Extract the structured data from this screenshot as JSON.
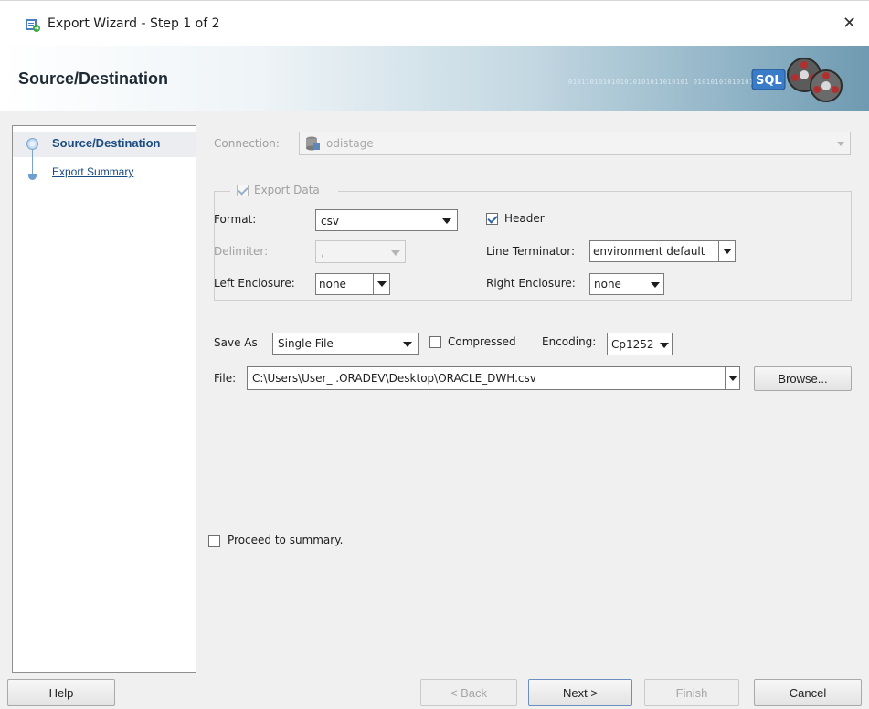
{
  "window": {
    "title": "Export Wizard - Step 1 of 2",
    "close_glyph": "✕"
  },
  "header": {
    "title": "Source/Destination",
    "decoration_text": "0101101010101010101011010101  0101010101010101"
  },
  "nav": {
    "items": [
      {
        "label": "Source/Destination",
        "selected": true
      },
      {
        "label": "Export Summary",
        "selected": false
      }
    ]
  },
  "connection": {
    "label": "Connection:",
    "value": "odistage"
  },
  "export_data": {
    "label": "Export Data",
    "checked": true
  },
  "format": {
    "label": "Format:",
    "value": "csv"
  },
  "header_option": {
    "label": "Header",
    "checked": true
  },
  "delimiter": {
    "label": "Delimiter:",
    "value": ","
  },
  "line_terminator": {
    "label": "Line Terminator:",
    "value": "environment default"
  },
  "left_enclosure": {
    "label": "Left Enclosure:",
    "value": "none"
  },
  "right_enclosure": {
    "label": "Right Enclosure:",
    "value": "none"
  },
  "save_as": {
    "label": "Save As",
    "value": "Single File"
  },
  "compressed": {
    "label": "Compressed",
    "checked": false
  },
  "encoding": {
    "label": "Encoding:",
    "value": "Cp1252"
  },
  "file": {
    "label": "File:",
    "value": "C:\\Users\\User_    .ORADEV\\Desktop\\ORACLE_DWH.csv"
  },
  "browse_button": "Browse...",
  "proceed_summary": {
    "label": "Proceed to summary.",
    "checked": false
  },
  "buttons": {
    "help": "Help",
    "back": "< Back",
    "next": "Next >",
    "finish": "Finish",
    "cancel": "Cancel"
  },
  "colors": {
    "link": "#1a4c82",
    "banner_end": "#6f9ab1",
    "check_mark": "#2f63a8"
  },
  "icons": {
    "title": "export-wizard-icon",
    "connection": "database-icon",
    "banner": "sql-film-reels-icon"
  }
}
